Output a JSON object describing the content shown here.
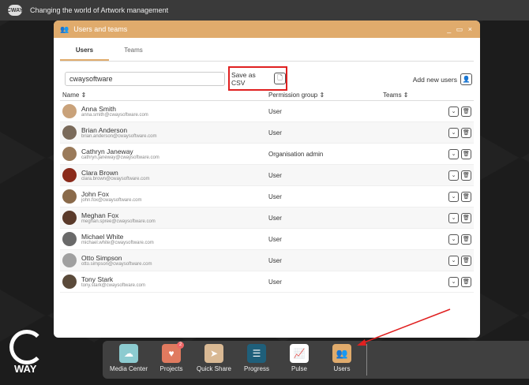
{
  "topbar": {
    "logo": "CWAY",
    "tagline": "Changing the world of Artwork management"
  },
  "window": {
    "title": "Users and teams",
    "controls": "_ ▭ ×"
  },
  "tabs": [
    {
      "label": "Users"
    },
    {
      "label": "Teams"
    }
  ],
  "toolbar": {
    "search_value": "cwaysoftware",
    "save_csv": "Save as CSV",
    "add_users": "Add new users"
  },
  "columns": {
    "name": "Name ⇕",
    "permission": "Permission group ⇕",
    "teams": "Teams ⇕"
  },
  "users": [
    {
      "name": "Anna Smith",
      "email": "anna.smith@cwaysoftware.com",
      "permission": "User",
      "color": "#c9a27a"
    },
    {
      "name": "Brian Anderson",
      "email": "brian.anderson@cwaysoftware.com",
      "permission": "User",
      "color": "#7a6a5a"
    },
    {
      "name": "Cathryn Janeway",
      "email": "cathryn.janeway@cwaysoftware.com",
      "permission": "Organisation admin",
      "color": "#9a7a5a"
    },
    {
      "name": "Clara Brown",
      "email": "clara.brown@cwaysoftware.com",
      "permission": "User",
      "color": "#8a2a1a"
    },
    {
      "name": "John Fox",
      "email": "john.fox@cwaysoftware.com",
      "permission": "User",
      "color": "#8a6a4a"
    },
    {
      "name": "Meghan Fox",
      "email": "meghan.spree@cwaysoftware.com",
      "permission": "User",
      "color": "#5a3a2a"
    },
    {
      "name": "Michael White",
      "email": "michael.white@cwaysoftware.com",
      "permission": "User",
      "color": "#6a6a6a"
    },
    {
      "name": "Otto Simpson",
      "email": "otto.simpson@cwaysoftware.com",
      "permission": "User",
      "color": "#a0a0a0"
    },
    {
      "name": "Tony Stark",
      "email": "tony.stark@cwaysoftware.com",
      "permission": "User",
      "color": "#5a4a3a"
    }
  ],
  "dock": [
    {
      "label": "Media Center",
      "color": "#8ccbd0",
      "icon": "☁"
    },
    {
      "label": "Projects",
      "color": "#e07a5f",
      "icon": "♥",
      "badge": "2"
    },
    {
      "label": "Quick Share",
      "color": "#d9b994",
      "icon": "➤"
    },
    {
      "label": "Progress",
      "color": "#1f5f7a",
      "icon": "☰"
    },
    {
      "label": "Pulse",
      "color": "#ffffff",
      "icon": "📈"
    },
    {
      "label": "Users",
      "color": "#e0ab6c",
      "icon": "👥"
    }
  ],
  "brand": {
    "logo_text": "WAY"
  }
}
